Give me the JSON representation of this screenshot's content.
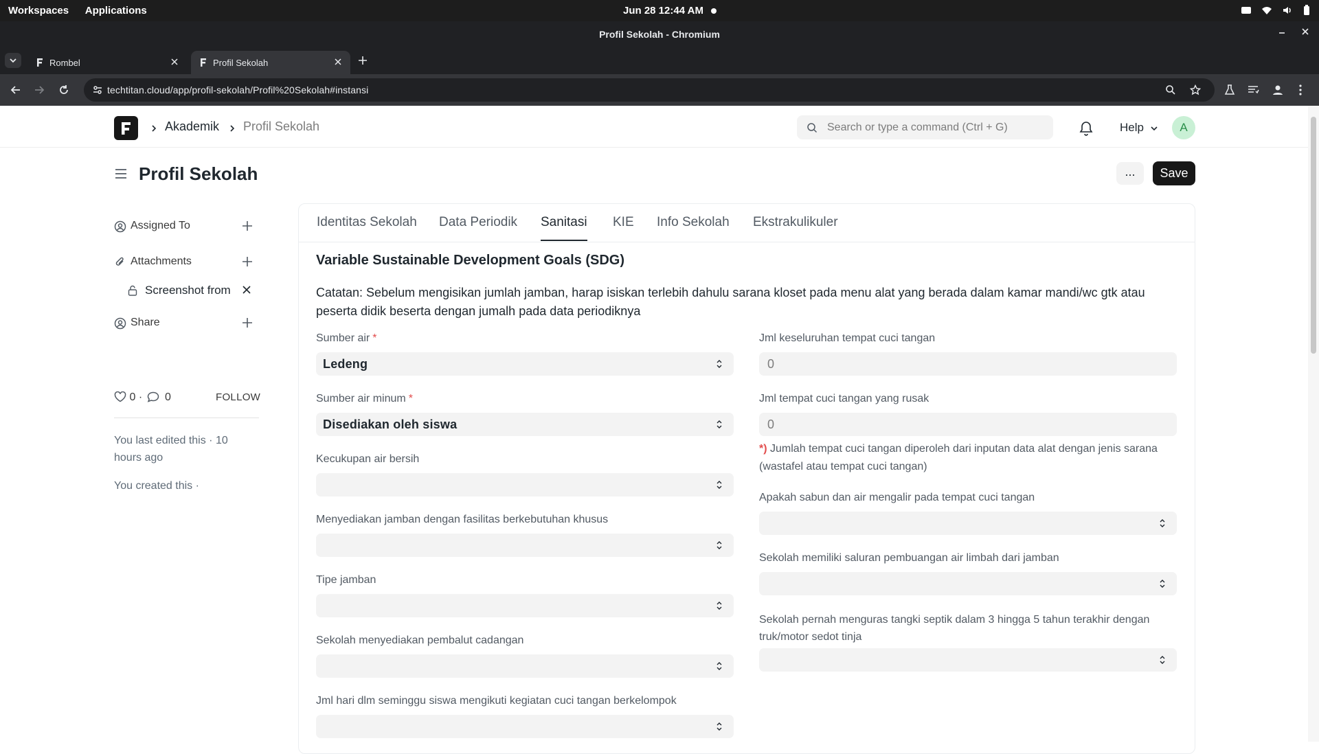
{
  "os": {
    "workspaces": "Workspaces",
    "applications": "Applications",
    "datetime": "Jun 28  12:44 AM"
  },
  "window": {
    "title": "Profil Sekolah - Chromium"
  },
  "browser": {
    "tabs": [
      {
        "label": "Rombel"
      },
      {
        "label": "Profil Sekolah"
      }
    ],
    "url": "techtitan.cloud/app/profil-sekolah/Profil%20Sekolah#instansi"
  },
  "navbar": {
    "breadcrumbs": [
      "Akademik",
      "Profil Sekolah"
    ],
    "search_placeholder": "Search or type a command (Ctrl + G)",
    "help": "Help",
    "avatar_letter": "A"
  },
  "page": {
    "title": "Profil Sekolah",
    "more": "...",
    "save": "Save"
  },
  "sidebar": {
    "assigned_to": "Assigned To",
    "attachments": "Attachments",
    "attachment_file": "Screenshot from",
    "share": "Share",
    "likes": "0",
    "comments": "0",
    "follow": "FOLLOW",
    "last_edited": "You last edited this · 10 hours ago",
    "created": "You created this ·"
  },
  "form": {
    "tabs": [
      "Identitas Sekolah",
      "Data Periodik",
      "Sanitasi",
      "KIE",
      "Info Sekolah",
      "Ekstrakulikuler"
    ],
    "active_tab": "Sanitasi",
    "section_title": "Variable Sustainable Development Goals (SDG)",
    "note": "Catatan: Sebelum mengisikan jumlah jamban, harap isiskan terlebih dahulu sarana kloset pada menu alat yang berada dalam kamar mandi/wc gtk atau peserta didik beserta dengan jumalh pada data periodiknya",
    "left_fields": [
      {
        "label": "Sumber air",
        "required": "*",
        "value": "Ledeng"
      },
      {
        "label": "Sumber air minum",
        "required": "*",
        "value": "Disediakan oleh siswa"
      },
      {
        "label": "Kecukupan air bersih",
        "value": ""
      },
      {
        "label": "Menyediakan jamban dengan fasilitas berkebutuhan khusus",
        "value": ""
      },
      {
        "label": "Tipe jamban",
        "value": ""
      },
      {
        "label": "Sekolah menyediakan pembalut cadangan",
        "value": ""
      },
      {
        "label": "Jml hari dlm seminggu siswa mengikuti kegiatan cuci tangan berkelompok",
        "value": ""
      }
    ],
    "right_fields": [
      {
        "label": "Jml keseluruhan tempat cuci tangan",
        "value": "0"
      },
      {
        "label": "Jml tempat cuci tangan yang rusak",
        "value": "0"
      },
      {
        "label": "Apakah sabun dan air mengalir pada tempat cuci tangan",
        "value": ""
      },
      {
        "label": "Sekolah memiliki saluran pembuangan air limbah dari jamban",
        "value": ""
      },
      {
        "label": "Sekolah pernah menguras tangki septik dalam 3 hingga 5 tahun terakhir dengan truk/motor sedot tinja",
        "value": ""
      }
    ],
    "hint_star": "*)",
    "hint": "Jumlah tempat cuci tangan diperoleh dari inputan data alat dengan jenis sarana (wastafel atau tempat cuci tangan)"
  },
  "colors": {
    "accent": "#171717",
    "required": "#e24c4c",
    "field_bg": "#f3f3f3"
  }
}
